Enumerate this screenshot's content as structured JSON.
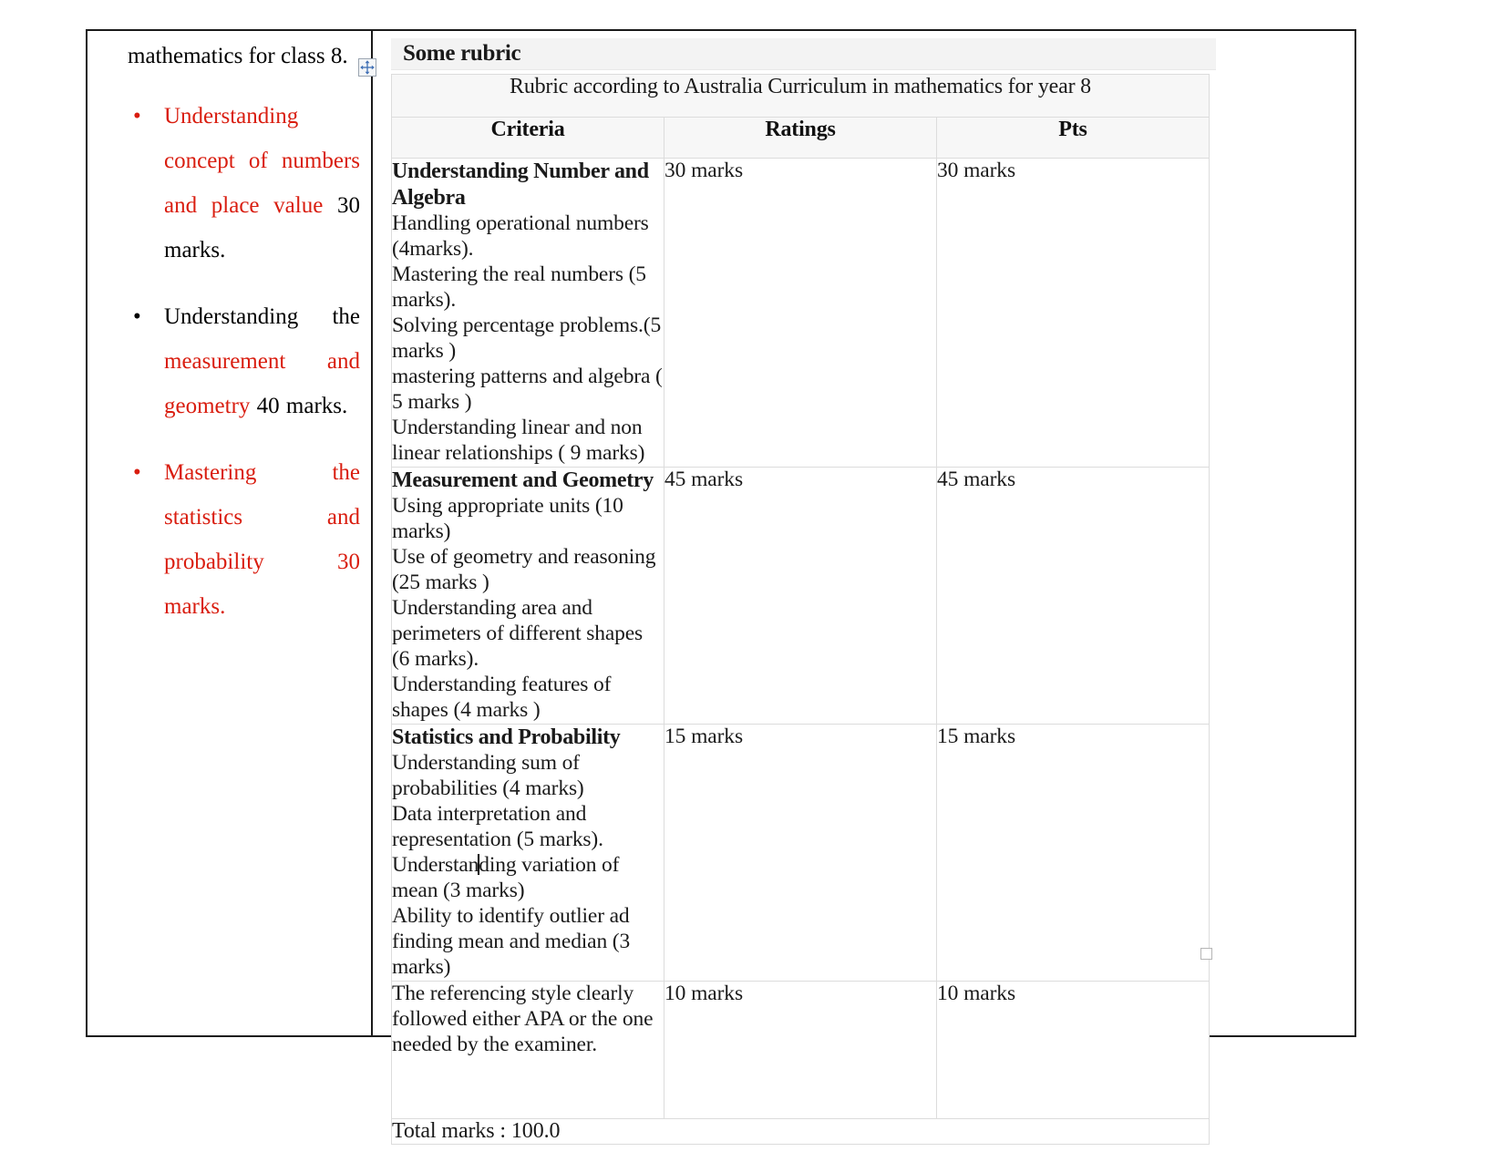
{
  "left_column": {
    "intro_text": "mathematics for class 8.",
    "bullets": [
      {
        "bullet_color": "red",
        "segments": [
          {
            "text": "Understanding concept of numbers and place value",
            "color": "red"
          },
          {
            "text": "  30 marks.",
            "color": "black"
          }
        ]
      },
      {
        "bullet_color": "black",
        "segments": [
          {
            "text": "Understanding the ",
            "color": "black"
          },
          {
            "text": "measurement and geometry",
            "color": "red"
          },
          {
            "text": " 40 marks.",
            "color": "black"
          }
        ]
      },
      {
        "bullet_color": "red",
        "segments": [
          {
            "text": "Mastering the statistics and probability 30 marks.",
            "color": "red"
          }
        ]
      }
    ]
  },
  "rubric": {
    "heading": "Some rubric",
    "caption": "Rubric according to Australia Curriculum in mathematics for year 8",
    "columns": [
      "Criteria",
      "Ratings",
      "Pts"
    ],
    "rows": [
      {
        "title": "Understanding Number and Algebra",
        "lines": [
          "Handling operational numbers (4marks).",
          "Mastering the real numbers (5 marks).",
          "Solving percentage problems.(5 marks )",
          "mastering patterns and algebra ( 5 marks )",
          "Understanding linear and non linear relationships ( 9 marks)"
        ],
        "ratings": "30 marks",
        "pts": "30 marks"
      },
      {
        "title": "Measurement and Geometry",
        "lines": [
          "Using appropriate units (10 marks)",
          "Use of geometry and reasoning (25 marks )",
          "Understanding area and perimeters of different shapes (6 marks).",
          "Understanding features of shapes (4 marks )"
        ],
        "ratings": "45 marks",
        "pts": "45 marks"
      },
      {
        "title": "Statistics and Probability",
        "lines": [
          "Understanding  sum of probabilities (4 marks)",
          "Data interpretation and representation (5 marks).",
          "Understanding variation of mean (3 marks)",
          "Ability to identify outlier ad finding mean and median (3 marks)"
        ],
        "ratings": "15 marks",
        "pts": "15 marks"
      },
      {
        "title": "",
        "lines": [
          "The referencing style clearly followed either APA or the one needed by the examiner."
        ],
        "ratings": "10 marks",
        "pts": "10 marks"
      }
    ],
    "total": "Total  marks : 100.0"
  },
  "colors": {
    "red_text": "#d91d0f",
    "body_text": "#1a1a1a",
    "table_border": "#dcdcdc",
    "header_fill": "#f7f7f7",
    "page_border": "#1a1a1a"
  },
  "icons": {
    "move_handle": "table-move-handle",
    "resize_handle": "table-resize-handle"
  }
}
